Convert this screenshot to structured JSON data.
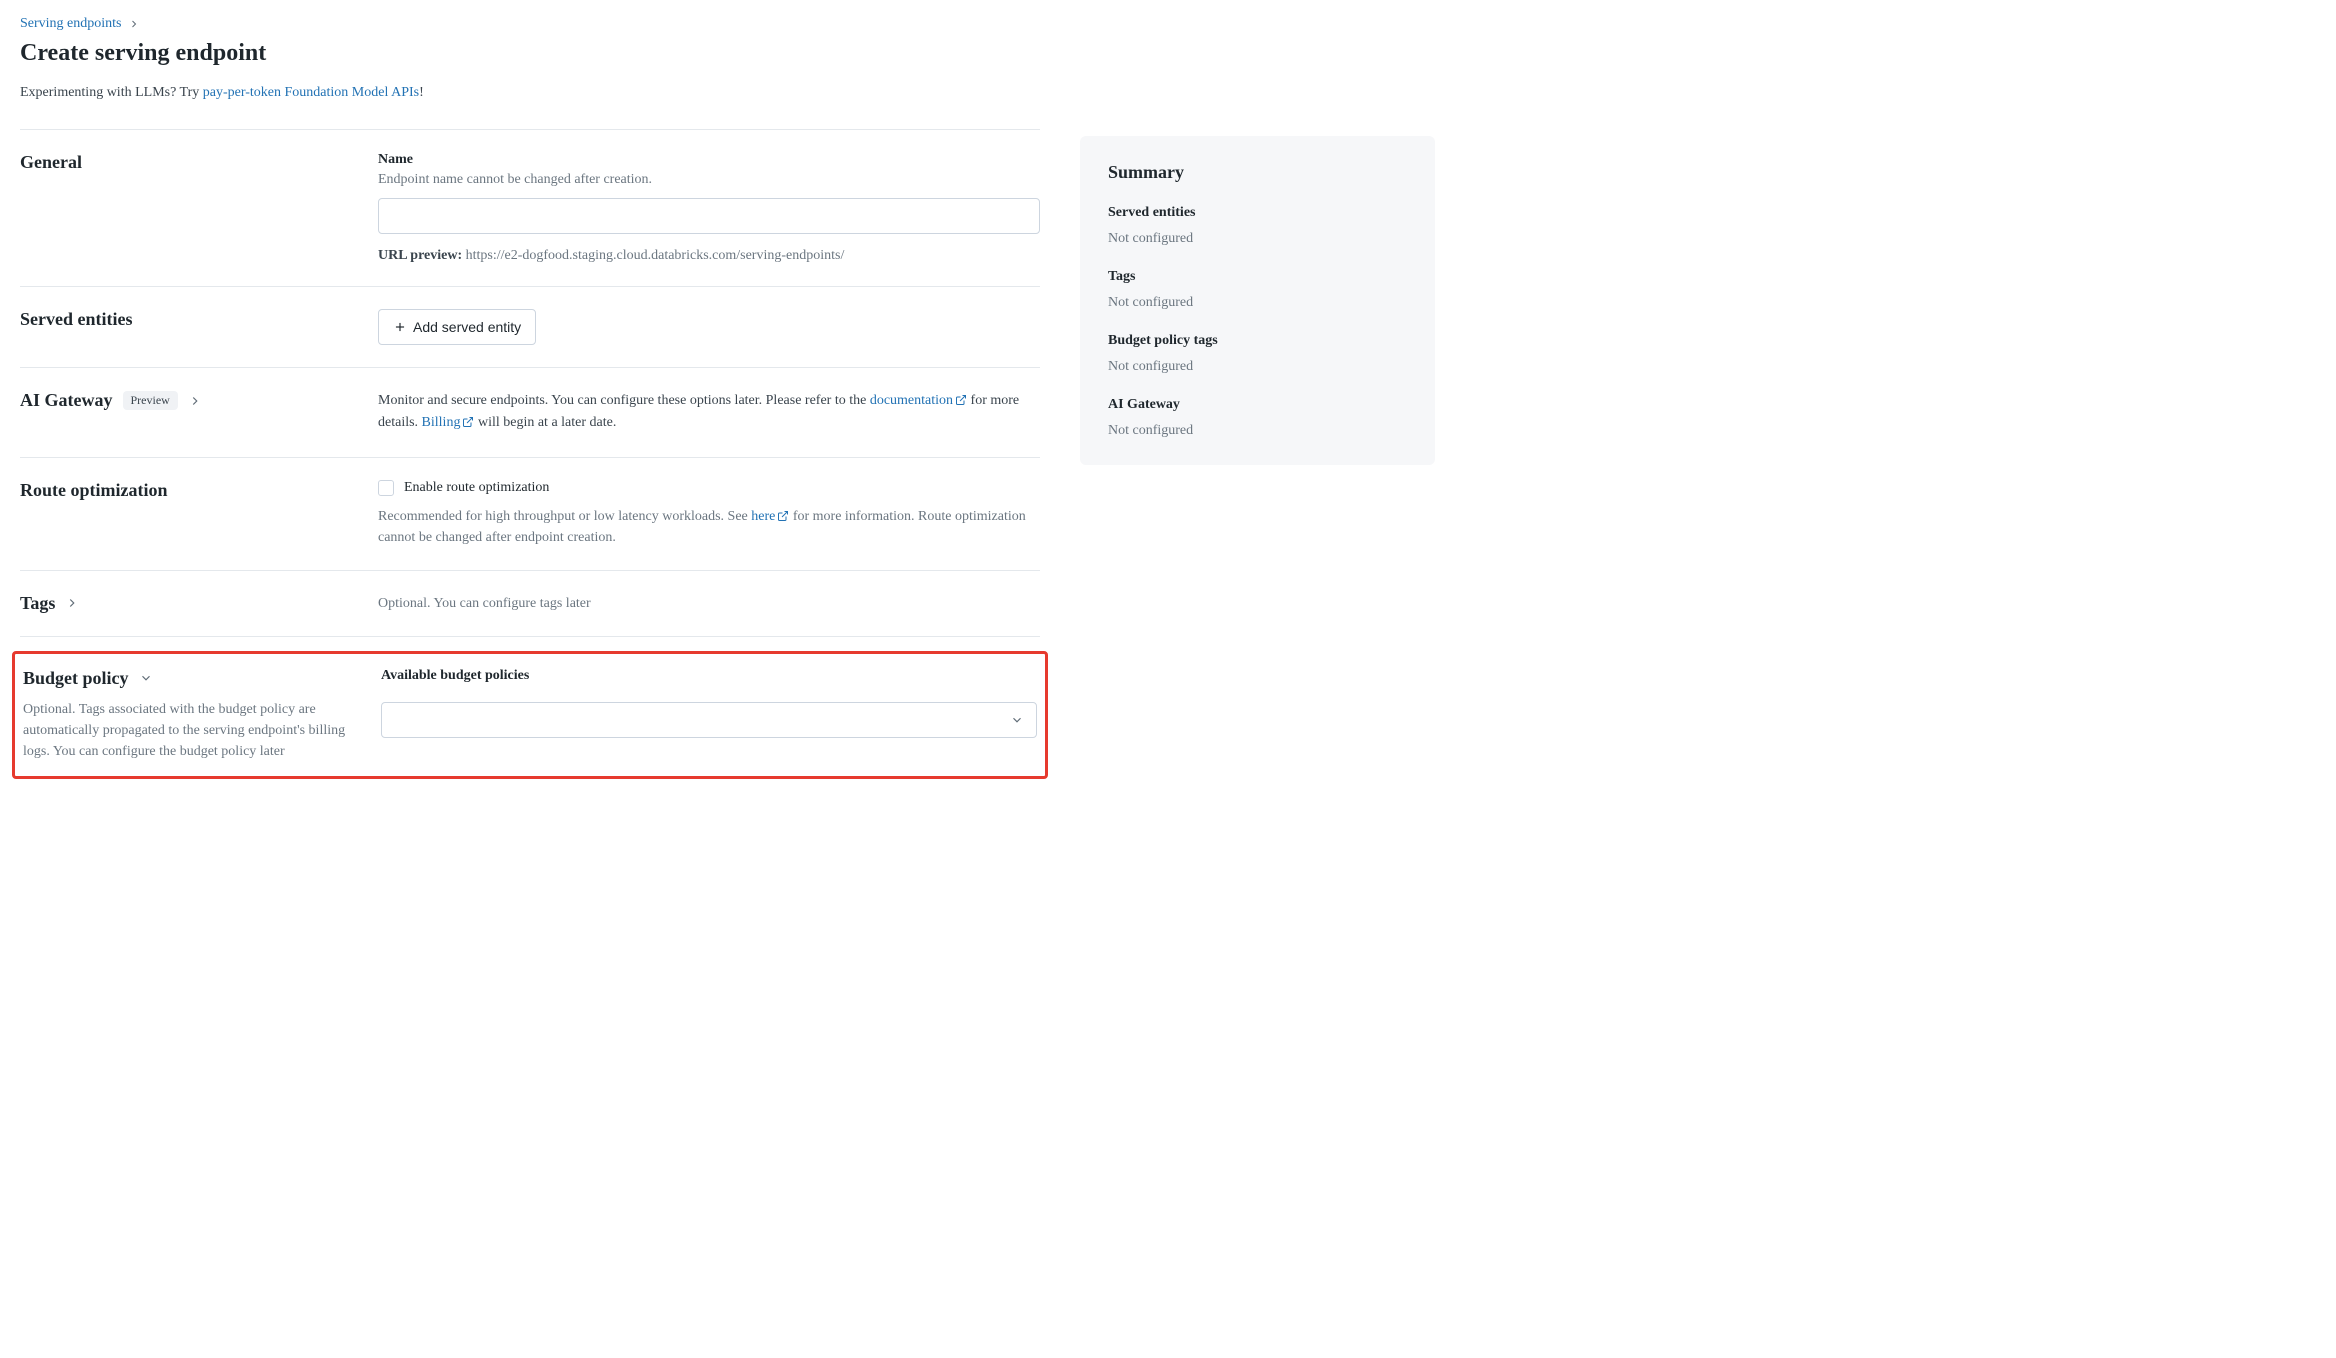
{
  "breadcrumb": {
    "parent": "Serving endpoints"
  },
  "title": "Create serving endpoint",
  "intro": {
    "prefix": "Experimenting with LLMs? Try ",
    "link": "pay-per-token Foundation Model APIs",
    "suffix": "!"
  },
  "general": {
    "heading": "General",
    "name_label": "Name",
    "name_help": "Endpoint name cannot be changed after creation.",
    "name_value": "",
    "url_preview_label": "URL preview:",
    "url_preview_value": "https://e2-dogfood.staging.cloud.databricks.com/serving-endpoints/"
  },
  "served": {
    "heading": "Served entities",
    "add_button": "Add served entity"
  },
  "ai_gateway": {
    "heading": "AI Gateway",
    "badge": "Preview",
    "desc_prefix": "Monitor and secure endpoints. You can configure these options later. Please refer to the ",
    "doc_link": "documentation",
    "desc_mid": " for more details. ",
    "billing_link": "Billing",
    "desc_suffix": " will begin at a later date."
  },
  "route_opt": {
    "heading": "Route optimization",
    "checkbox_label": "Enable route optimization",
    "help_prefix": "Recommended for high throughput or low latency workloads. See ",
    "help_link": "here",
    "help_suffix": " for more information. Route optimization cannot be changed after endpoint creation."
  },
  "tags": {
    "heading": "Tags",
    "desc": "Optional. You can configure tags later"
  },
  "budget": {
    "heading": "Budget policy",
    "desc": "Optional. Tags associated with the budget policy are automatically propagated to the serving endpoint's billing logs. You can configure the budget policy later",
    "field_label": "Available budget policies"
  },
  "summary": {
    "heading": "Summary",
    "items": [
      {
        "label": "Served entities",
        "value": "Not configured"
      },
      {
        "label": "Tags",
        "value": "Not configured"
      },
      {
        "label": "Budget policy tags",
        "value": "Not configured"
      },
      {
        "label": "AI Gateway",
        "value": "Not configured"
      }
    ]
  }
}
